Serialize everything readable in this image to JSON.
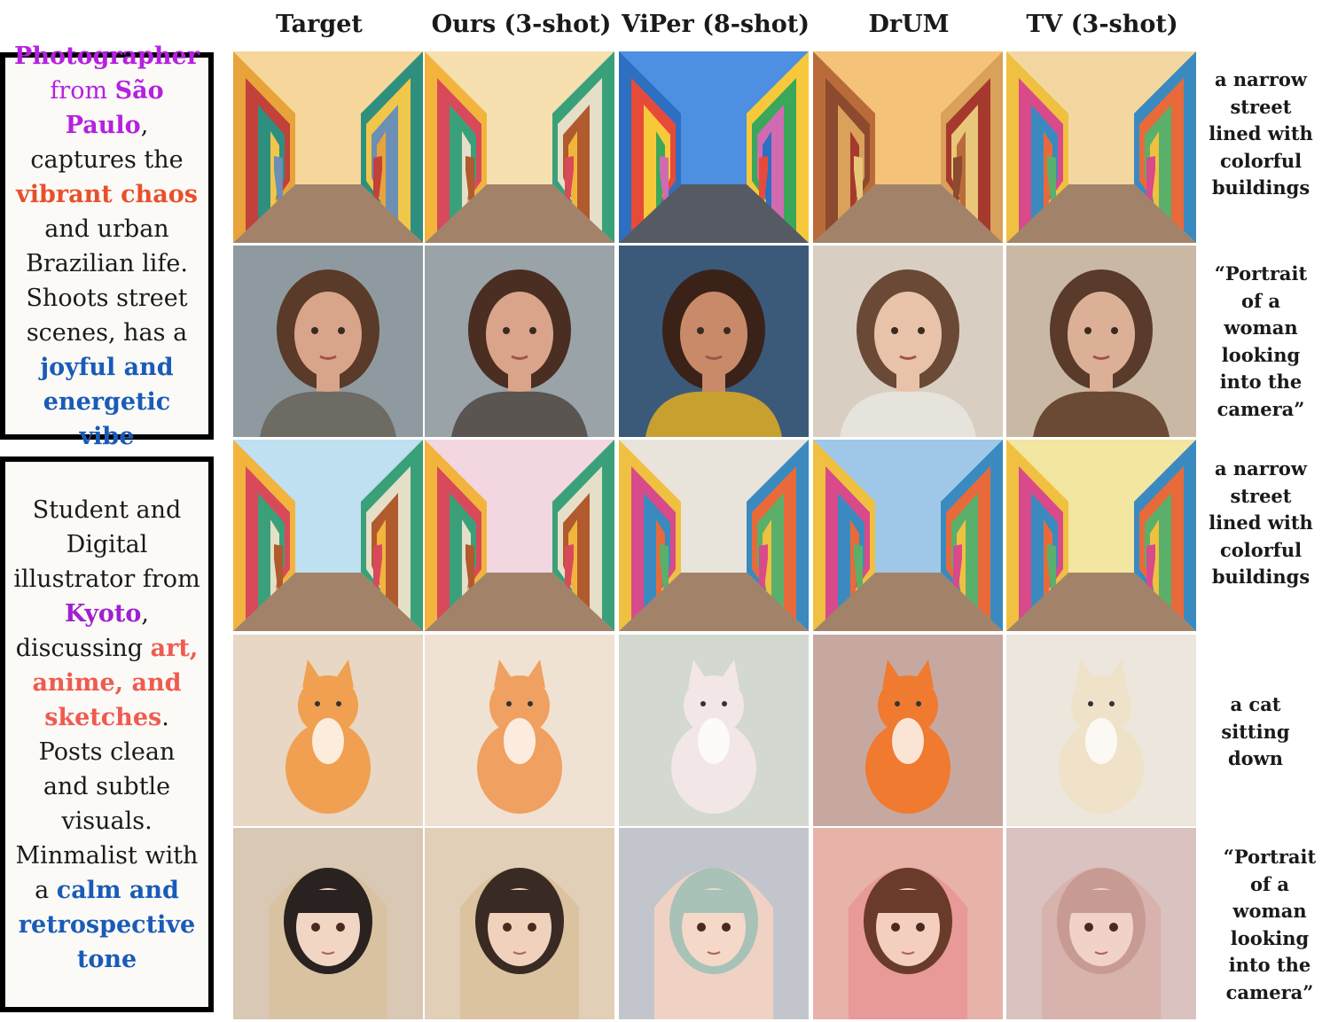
{
  "headers": [
    "Target",
    "Ours (3-shot)",
    "ViPer (8-shot)",
    "DrUM",
    "TV (3-shot)"
  ],
  "personas": [
    {
      "segments": [
        {
          "t": "Photographer",
          "c": "#b620e0"
        },
        {
          "t": " from ",
          "c": "#b620e0",
          "w": "normal"
        },
        {
          "t": "São Paulo",
          "c": "#b620e0"
        },
        {
          "t": ", captures the ",
          "c": "#1a1a1a",
          "w": "normal"
        },
        {
          "t": "vibrant chaos",
          "c": "#e8502b"
        },
        {
          "t": " and urban Brazilian life. Shoots street scenes, has a ",
          "c": "#1a1a1a",
          "w": "normal"
        },
        {
          "t": "joyful and energetic vibe",
          "c": "#1a5bb8"
        }
      ]
    },
    {
      "segments": [
        {
          "t": "Student and Digital illustrator from ",
          "c": "#1a1a1a",
          "w": "normal"
        },
        {
          "t": "Kyoto",
          "c": "#a020d0"
        },
        {
          "t": ", discussing ",
          "c": "#1a1a1a",
          "w": "normal"
        },
        {
          "t": "art, anime, and sketches",
          "c": "#f05a50"
        },
        {
          "t": ". Posts clean and subtle visuals. Minmalist with a ",
          "c": "#1a1a1a",
          "w": "normal"
        },
        {
          "t": "calm and retrospective tone",
          "c": "#1a5bb8"
        }
      ]
    }
  ],
  "prompts": [
    "a narrow street lined with colorful buildings",
    "“Portrait of a woman looking into the camera”",
    "a narrow street lined with colorful buildings",
    "a cat sitting down",
    "“Portrait of a woman looking into the camera”"
  ],
  "rows": [
    "street-photo",
    "portrait-photo",
    "street-illustration",
    "cat-illustration",
    "portrait-illustration"
  ]
}
